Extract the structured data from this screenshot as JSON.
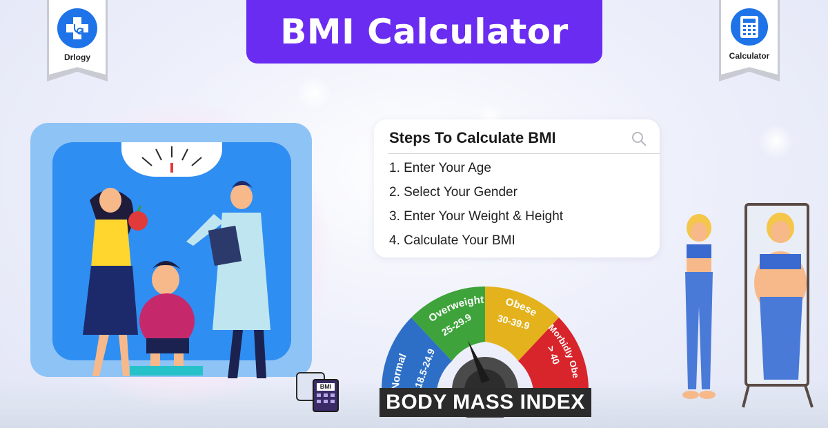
{
  "header": {
    "title": "BMI Calculator"
  },
  "badges": {
    "left": {
      "label": "Drlogy",
      "icon": "stethoscope-plus-icon"
    },
    "right": {
      "label": "Calculator",
      "icon": "calculator-icon"
    }
  },
  "steps": {
    "title": "Steps To Calculate BMI",
    "search_icon": "search-icon",
    "items": [
      "1.  Enter Your Age",
      "2.  Select Your Gender",
      "3.  Enter Your Weight & Height",
      "4.  Calculate Your BMI"
    ]
  },
  "gauge": {
    "banner": "BODY MASS INDEX",
    "segments": [
      {
        "name": "Normal",
        "range": "18.5-24.9",
        "color": "#2d6fc6"
      },
      {
        "name": "Overweight",
        "range": "25-29.9",
        "color": "#3ea33b"
      },
      {
        "name": "Obese",
        "range": "30-39.9",
        "color": "#e4b21c"
      },
      {
        "name": "Morbidly Obese",
        "range": "> 40",
        "color": "#d8242b"
      }
    ]
  },
  "mini_icon": {
    "label": "BMI"
  },
  "colors": {
    "accent": "#6a2cf0",
    "badge_blue": "#1e73e8",
    "scale_blue": "#2f8ef2"
  }
}
